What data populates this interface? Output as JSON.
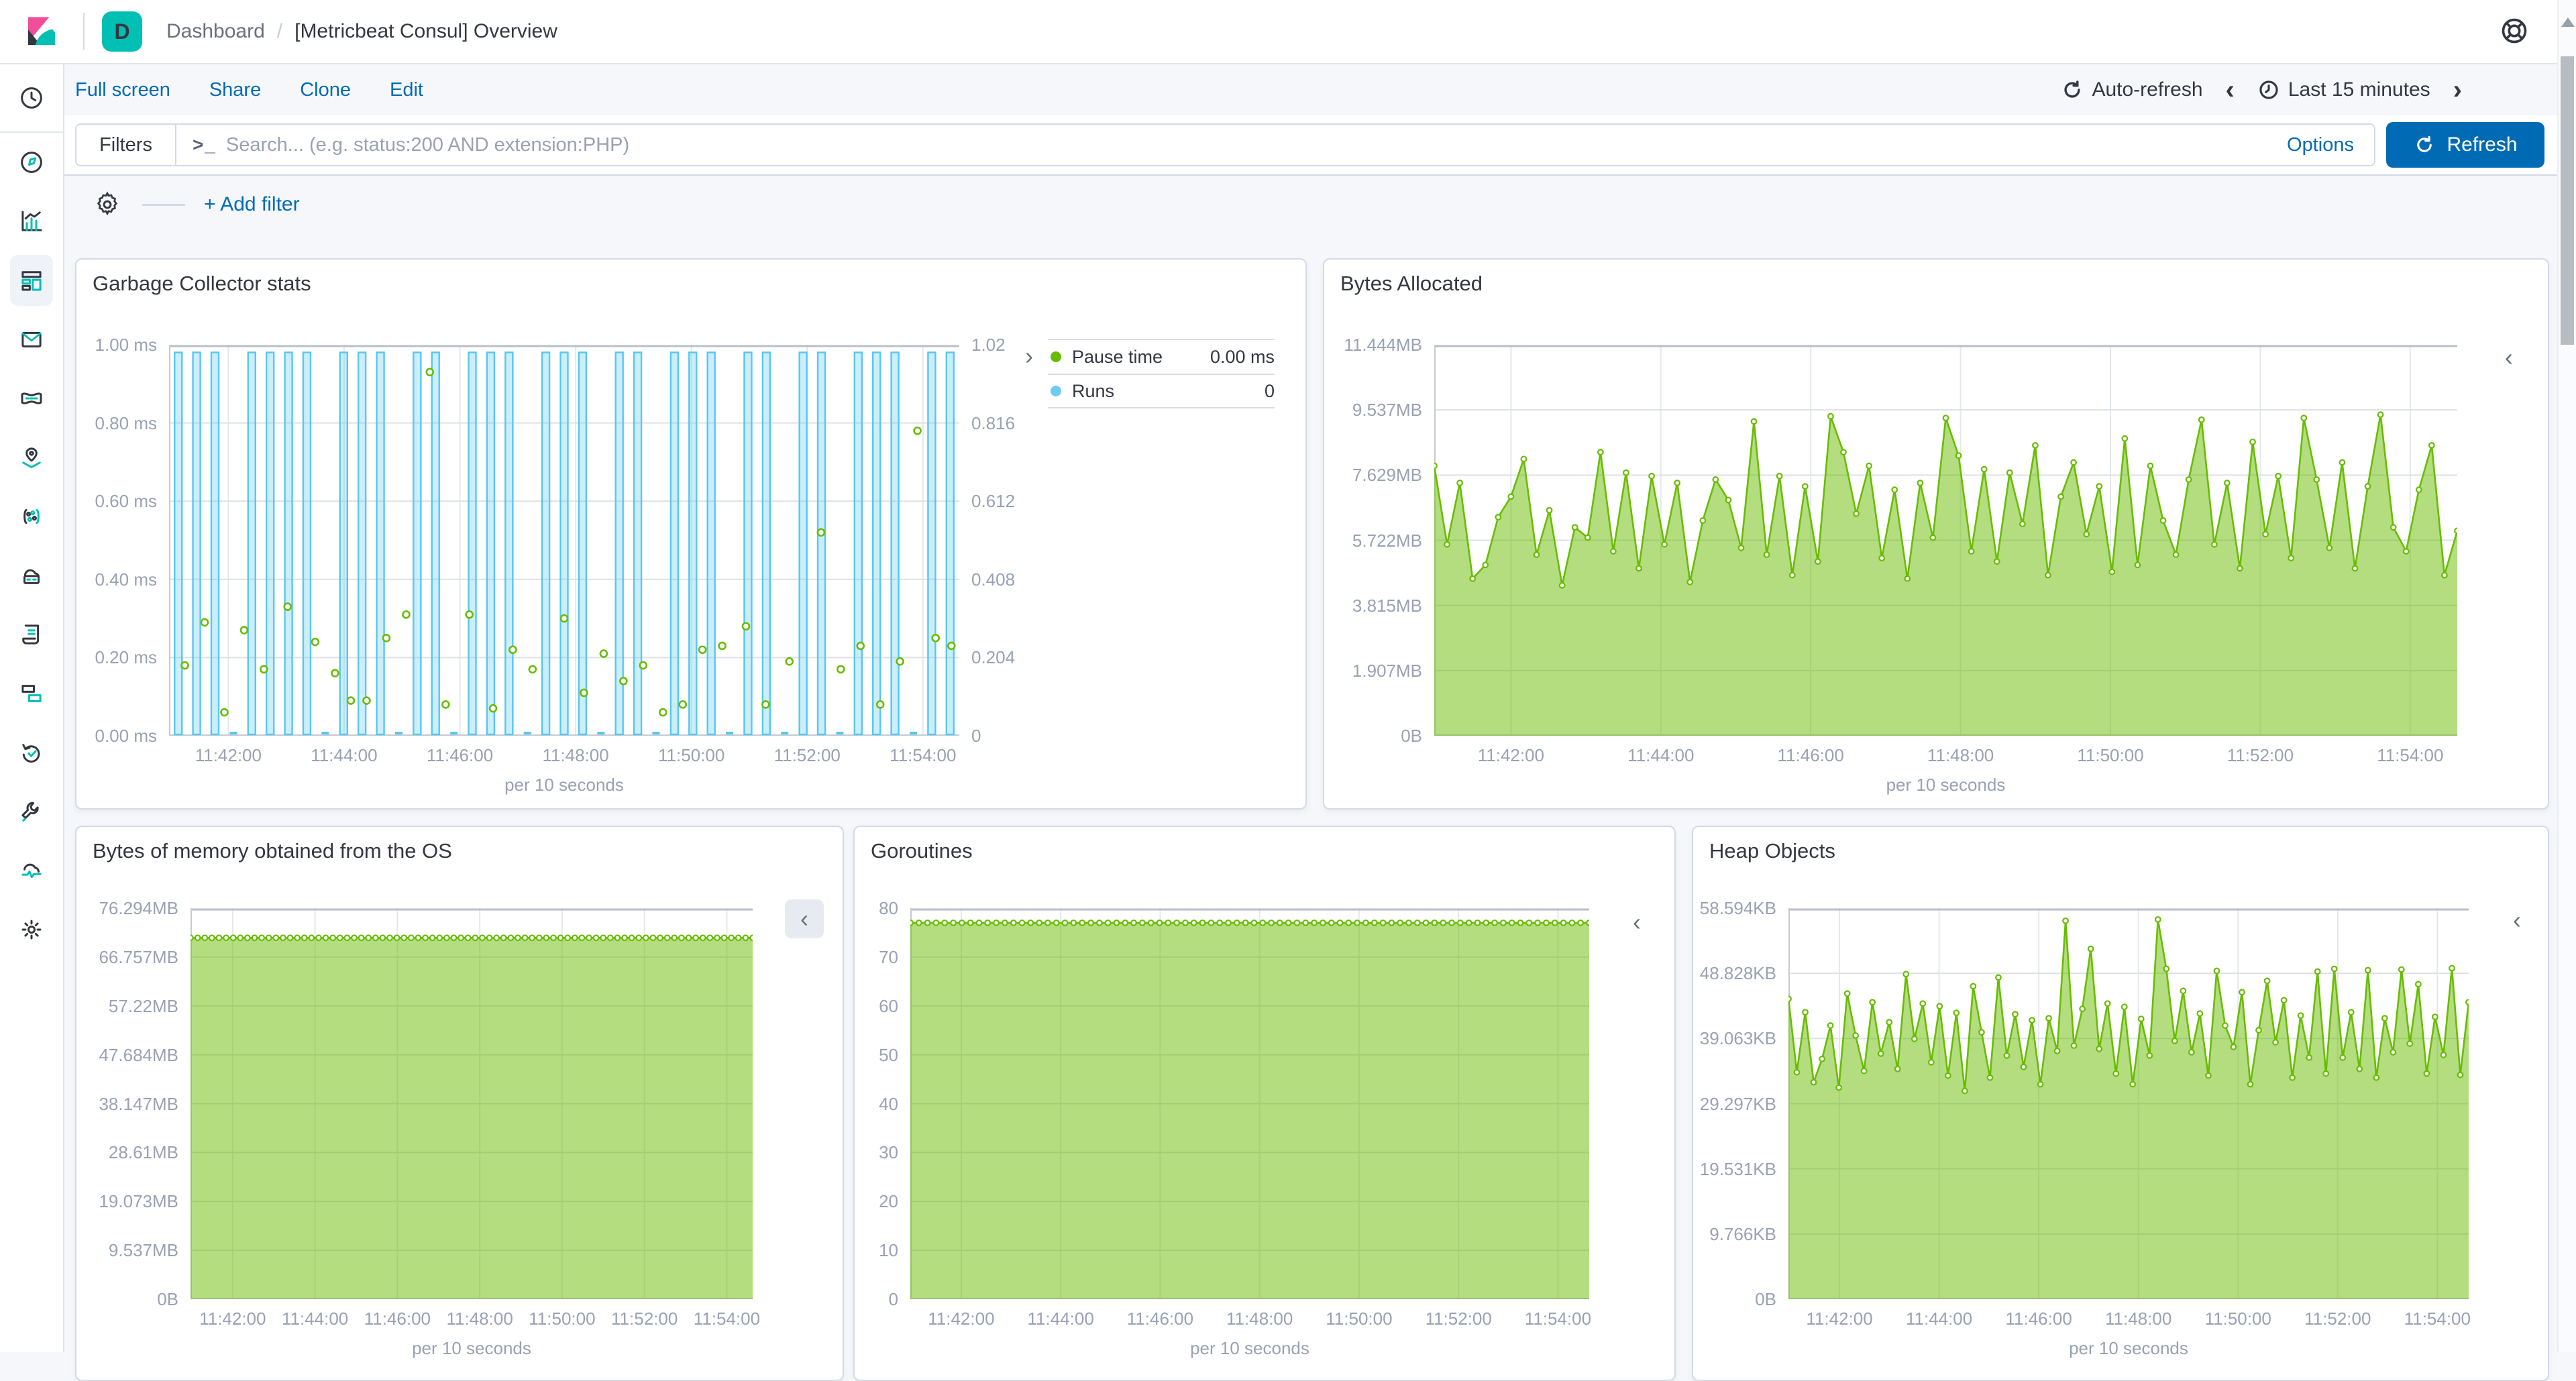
{
  "topbar": {
    "badge": "D",
    "breadcrumb": [
      "Dashboard",
      "[Metricbeat Consul] Overview"
    ],
    "separator": "/"
  },
  "menubar": {
    "links": [
      "Full screen",
      "Share",
      "Clone",
      "Edit"
    ],
    "auto_refresh_label": "Auto-refresh",
    "time_back": "‹",
    "time_range": "Last 15 minutes",
    "time_forward": "›"
  },
  "querybar": {
    "filters_label": "Filters",
    "terminal_icon": ">_",
    "search_placeholder": "Search... (e.g. status:200 AND extension:PHP)",
    "search_value": "",
    "options_label": "Options",
    "refresh_label": "Refresh"
  },
  "filterbar": {
    "add_filter_label": "+ Add filter"
  },
  "sidebar": {
    "selected": "dashboard",
    "items": [
      "recently-viewed",
      "discover",
      "visualize",
      "dashboard",
      "canvas",
      "machine-learning",
      "maps",
      "apm",
      "infrastructure",
      "logs",
      "siem",
      "uptime",
      "dev-tools",
      "stack-monitoring",
      "management"
    ]
  },
  "scrollbar": {
    "present": true
  },
  "colors": {
    "accent_blue": "#006BB4",
    "teal": "#00BFB3",
    "series_green": "#68BC00",
    "series_blue": "#6DCCF2",
    "panel_border": "#D3DAE6",
    "page_bg": "#F5F7FA",
    "text": "#343741",
    "axis_text": "#98A2B3"
  },
  "chart_data": [
    {
      "id": "gc",
      "title": "Garbage Collector stats",
      "type": "bar+scatter",
      "x_labels": [
        "11:42:00",
        "11:44:00",
        "11:46:00",
        "11:48:00",
        "11:50:00",
        "11:52:00",
        "11:54:00"
      ],
      "x_first_frac": 0.075,
      "x_step_frac": 0.1465,
      "x_unit": "per 10 seconds",
      "y_left": {
        "labels": [
          "1.00 ms",
          "0.80 ms",
          "0.60 ms",
          "0.40 ms",
          "0.20 ms",
          "0.00 ms"
        ],
        "values": [
          1,
          0.8,
          0.6,
          0.4,
          0.2,
          0
        ],
        "max": 1
      },
      "y_right": {
        "labels": [
          "1.02",
          "0.816",
          "0.612",
          "0.408",
          "0.204",
          "0"
        ],
        "values": [
          1.02,
          0.816,
          0.612,
          0.408,
          0.204,
          0
        ],
        "max": 1.02
      },
      "series": [
        {
          "name": "Runs",
          "type": "bar",
          "color": "#55C8F0",
          "fill": "rgba(109,204,242,0.35)",
          "bar_value": 1,
          "slots": [
            1,
            1,
            1,
            0,
            1,
            1,
            1,
            1,
            0,
            1,
            1,
            1,
            0,
            1,
            1,
            0,
            1,
            1,
            1,
            0,
            1,
            1,
            1,
            0,
            1,
            1,
            0,
            1,
            1,
            1,
            0,
            1,
            1,
            0,
            1,
            1,
            0,
            1,
            1,
            1,
            0,
            1,
            1
          ]
        },
        {
          "name": "Pause time",
          "type": "scatter",
          "color": "#68BC00",
          "unit": "ms",
          "points": [
            [
              0.02,
              0.18
            ],
            [
              0.045,
              0.29
            ],
            [
              0.07,
              0.06
            ],
            [
              0.095,
              0.27
            ],
            [
              0.12,
              0.17
            ],
            [
              0.15,
              0.33
            ],
            [
              0.185,
              0.24
            ],
            [
              0.21,
              0.16
            ],
            [
              0.23,
              0.09
            ],
            [
              0.25,
              0.09
            ],
            [
              0.275,
              0.25
            ],
            [
              0.3,
              0.31
            ],
            [
              0.33,
              0.93
            ],
            [
              0.35,
              0.08
            ],
            [
              0.38,
              0.31
            ],
            [
              0.41,
              0.07
            ],
            [
              0.435,
              0.22
            ],
            [
              0.46,
              0.17
            ],
            [
              0.5,
              0.3
            ],
            [
              0.525,
              0.11
            ],
            [
              0.55,
              0.21
            ],
            [
              0.575,
              0.14
            ],
            [
              0.6,
              0.18
            ],
            [
              0.625,
              0.06
            ],
            [
              0.65,
              0.08
            ],
            [
              0.675,
              0.22
            ],
            [
              0.7,
              0.23
            ],
            [
              0.73,
              0.28
            ],
            [
              0.755,
              0.08
            ],
            [
              0.785,
              0.19
            ],
            [
              0.825,
              0.52
            ],
            [
              0.85,
              0.17
            ],
            [
              0.875,
              0.23
            ],
            [
              0.9,
              0.08
            ],
            [
              0.925,
              0.19
            ],
            [
              0.947,
              0.78
            ],
            [
              0.97,
              0.25
            ],
            [
              0.99,
              0.23
            ]
          ]
        }
      ],
      "legend": {
        "toggle": "›",
        "rows": [
          {
            "label": "Pause time",
            "color": "#68BC00",
            "value": "0.00 ms"
          },
          {
            "label": "Runs",
            "color": "#6DCCF2",
            "value": "0"
          }
        ]
      },
      "layout": {
        "plot": [
          138,
          127,
          1178,
          583
        ],
        "legend": [
          1448,
          118,
          338
        ],
        "legend_chevron": [
          1414,
          126
        ]
      }
    },
    {
      "id": "bytes-allocated",
      "title": "Bytes Allocated",
      "type": "area",
      "x_labels": [
        "11:42:00",
        "11:44:00",
        "11:46:00",
        "11:48:00",
        "11:50:00",
        "11:52:00",
        "11:54:00"
      ],
      "x_first_frac": 0.075,
      "x_step_frac": 0.1465,
      "x_unit": "per 10 seconds",
      "y_left": {
        "labels": [
          "11.444MB",
          "9.537MB",
          "7.629MB",
          "5.722MB",
          "3.815MB",
          "1.907MB",
          "0B"
        ],
        "values": [
          11.444,
          9.537,
          7.629,
          5.722,
          3.815,
          1.907,
          0
        ],
        "max": 11.444
      },
      "series": [
        {
          "name": "Bytes Allocated",
          "type": "area",
          "color": "#68BC00",
          "fill_opacity": 0.5,
          "unit": "MB",
          "values": [
            7.9,
            5.6,
            7.4,
            4.6,
            5.0,
            6.4,
            7.0,
            8.1,
            5.3,
            6.6,
            4.4,
            6.1,
            5.8,
            8.3,
            5.4,
            7.7,
            4.9,
            7.6,
            5.6,
            7.4,
            4.5,
            6.3,
            7.5,
            6.9,
            5.5,
            9.2,
            5.3,
            7.6,
            4.7,
            7.3,
            5.1,
            9.35,
            8.3,
            6.5,
            7.9,
            5.2,
            7.2,
            4.6,
            7.4,
            5.8,
            9.3,
            8.2,
            5.4,
            7.8,
            5.1,
            7.7,
            6.2,
            8.5,
            4.7,
            7.0,
            8.0,
            5.9,
            7.3,
            4.8,
            8.7,
            5.0,
            7.9,
            6.3,
            5.3,
            7.5,
            9.25,
            5.6,
            7.4,
            4.9,
            8.6,
            5.9,
            7.6,
            5.2,
            9.3,
            7.5,
            5.5,
            8.0,
            4.9,
            7.3,
            9.4,
            6.1,
            5.4,
            7.2,
            8.5,
            4.7,
            6.0
          ]
        }
      ],
      "collapse": {
        "x": 1760,
        "y": 128,
        "char": "‹",
        "boxed": false
      },
      "layout": {
        "plot": [
          164,
          127,
          1525,
          583
        ]
      }
    },
    {
      "id": "os-memory",
      "title": "Bytes of memory obtained from the OS",
      "type": "area",
      "x_labels": [
        "11:42:00",
        "11:44:00",
        "11:46:00",
        "11:48:00",
        "11:50:00",
        "11:52:00",
        "11:54:00"
      ],
      "x_first_frac": 0.075,
      "x_step_frac": 0.1465,
      "x_unit": "per 10 seconds",
      "y_left": {
        "labels": [
          "76.294MB",
          "66.757MB",
          "57.22MB",
          "47.684MB",
          "38.147MB",
          "28.61MB",
          "19.073MB",
          "9.537MB",
          "0B"
        ],
        "values": [
          76.294,
          66.757,
          57.22,
          47.684,
          38.147,
          28.61,
          19.073,
          9.537,
          0
        ],
        "max": 76.294
      },
      "series": [
        {
          "name": "Bytes of memory obtained from the OS",
          "type": "area",
          "color": "#68BC00",
          "fill_opacity": 0.5,
          "unit": "MB",
          "flat": 70.5,
          "count": 80
        }
      ],
      "collapse": {
        "x": 1056,
        "y": 108,
        "char": "‹",
        "boxed": true
      },
      "layout": {
        "plot": [
          170,
          121,
          838,
          583
        ]
      }
    },
    {
      "id": "goroutines",
      "title": "Goroutines",
      "type": "area",
      "x_labels": [
        "11:42:00",
        "11:44:00",
        "11:46:00",
        "11:48:00",
        "11:50:00",
        "11:52:00",
        "11:54:00"
      ],
      "x_first_frac": 0.075,
      "x_step_frac": 0.1465,
      "x_unit": "per 10 seconds",
      "y_left": {
        "labels": [
          "80",
          "70",
          "60",
          "50",
          "40",
          "30",
          "20",
          "10",
          "0"
        ],
        "values": [
          80,
          70,
          60,
          50,
          40,
          30,
          20,
          10,
          0
        ],
        "max": 80
      },
      "series": [
        {
          "name": "Goroutines",
          "type": "area",
          "color": "#68BC00",
          "fill_opacity": 0.5,
          "flat": 77,
          "count": 80
        }
      ],
      "collapse": {
        "x": 1160,
        "y": 124,
        "char": "‹",
        "boxed": false
      },
      "layout": {
        "plot": [
          83,
          121,
          1012,
          583
        ]
      }
    },
    {
      "id": "heap-objects",
      "title": "Heap Objects",
      "type": "area",
      "x_labels": [
        "11:42:00",
        "11:44:00",
        "11:46:00",
        "11:48:00",
        "11:50:00",
        "11:52:00",
        "11:54:00"
      ],
      "x_first_frac": 0.075,
      "x_step_frac": 0.1465,
      "x_unit": "per 10 seconds",
      "y_left": {
        "labels": [
          "58.594KB",
          "48.828KB",
          "39.063KB",
          "29.297KB",
          "19.531KB",
          "9.766KB",
          "0B"
        ],
        "values": [
          58.594,
          48.828,
          39.063,
          29.297,
          19.531,
          9.766,
          0
        ],
        "max": 58.594
      },
      "series": [
        {
          "name": "Heap Objects",
          "type": "area",
          "color": "#68BC00",
          "fill_opacity": 0.5,
          "unit": "KB",
          "values": [
            45,
            34,
            43,
            32.5,
            36,
            41,
            31.7,
            45.8,
            39.5,
            34.2,
            44.5,
            36.8,
            41.5,
            34.5,
            48.7,
            39,
            44.3,
            35.5,
            43.9,
            33.5,
            42.9,
            31.2,
            46.9,
            40,
            33.2,
            48.2,
            36.5,
            42.7,
            34.8,
            41.8,
            32.2,
            42.1,
            37.2,
            56.7,
            38,
            43.5,
            52.5,
            37.5,
            44.3,
            33.8,
            43.8,
            32.2,
            42,
            36.5,
            56.9,
            49.5,
            38.7,
            46.2,
            37,
            42.8,
            33.5,
            49.2,
            41,
            37.8,
            46,
            32.2,
            40.3,
            47.7,
            38.5,
            44.8,
            33.2,
            42.5,
            36.2,
            49.1,
            33.8,
            49.5,
            36.2,
            43,
            34.5,
            49.3,
            33.2,
            42.1,
            37,
            49.4,
            38.3,
            47.2,
            33.8,
            42.3,
            36.6,
            49.6,
            33.6,
            44.5
          ]
        }
      ],
      "collapse": {
        "x": 1222,
        "y": 121,
        "char": "‹",
        "boxed": false
      },
      "layout": {
        "plot": [
          142,
          121,
          1014,
          583
        ]
      }
    }
  ]
}
